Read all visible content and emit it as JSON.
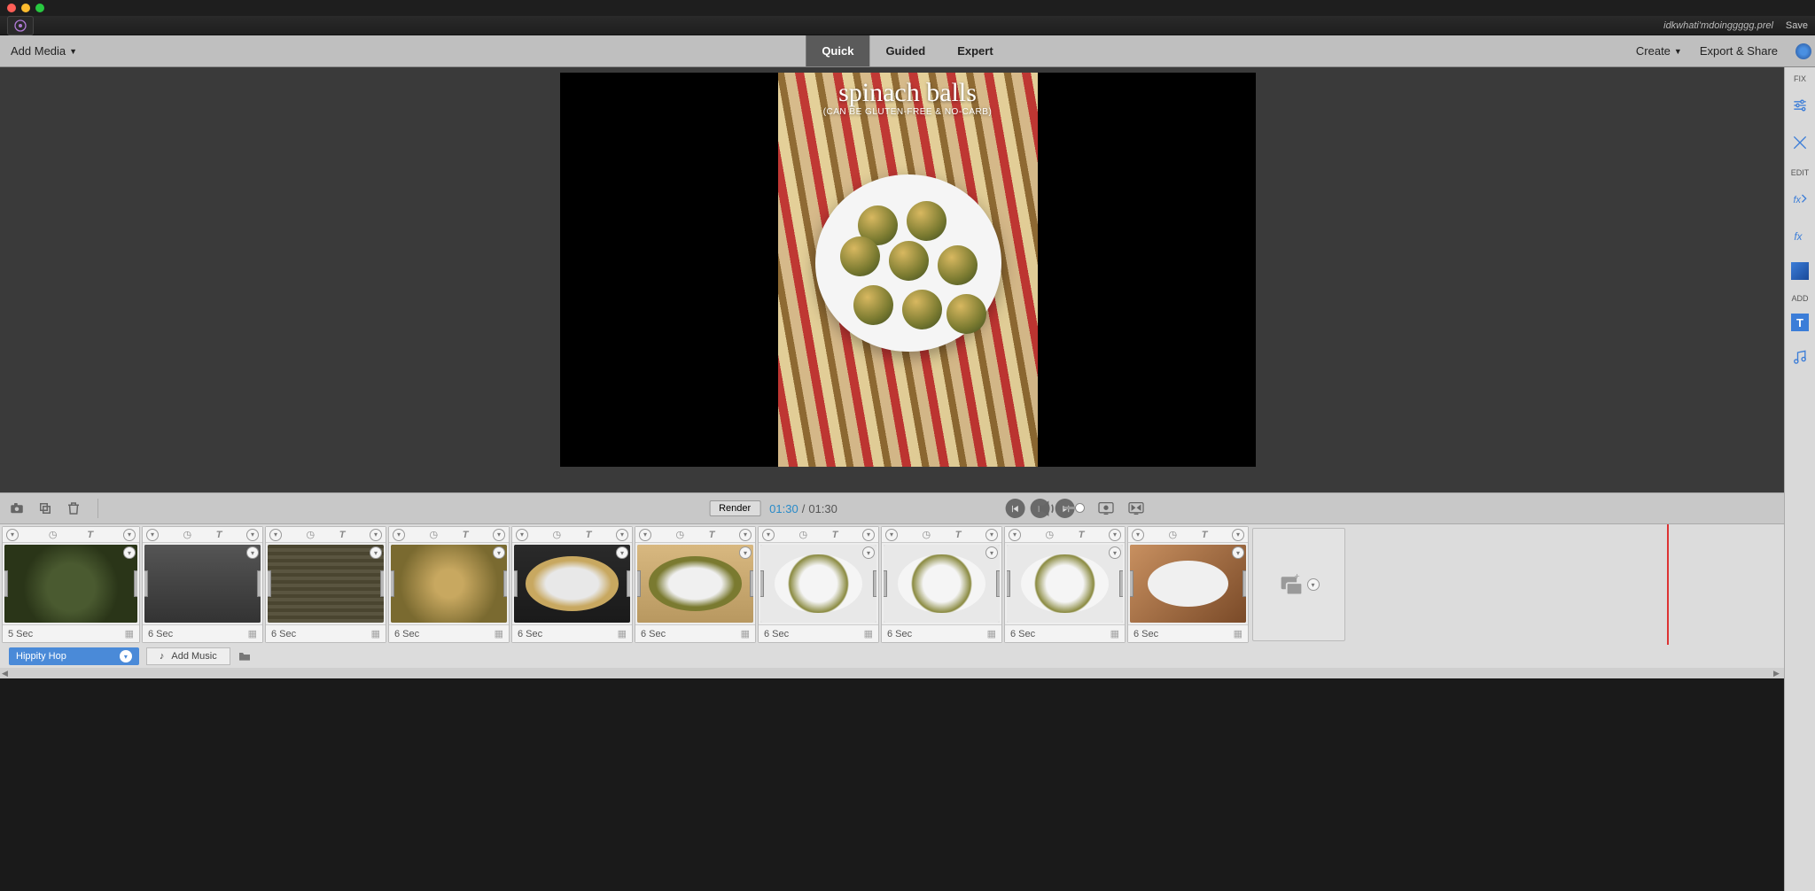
{
  "titlebar": {
    "filename": "idkwhati'mdoinggggg.prel",
    "save": "Save"
  },
  "menubar": {
    "addMedia": "Add Media",
    "tabs": {
      "quick": "Quick",
      "guided": "Guided",
      "expert": "Expert"
    },
    "create": "Create",
    "exportShare": "Export & Share"
  },
  "preview": {
    "title": "spinach balls",
    "subtitle": "(CAN BE GLUTEN-FREE & NO-CARB)"
  },
  "sidepanel": {
    "fix": "FIX",
    "edit": "EDIT",
    "add": "ADD",
    "t": "T"
  },
  "controls": {
    "render": "Render",
    "current": "01:30",
    "sep": "/",
    "total": "01:30"
  },
  "clips": [
    {
      "dur": "5 Sec",
      "thumbCls": "mt1"
    },
    {
      "dur": "6 Sec",
      "thumbCls": "mt2"
    },
    {
      "dur": "6 Sec",
      "thumbCls": "mt3"
    },
    {
      "dur": "6 Sec",
      "thumbCls": "mt4"
    },
    {
      "dur": "6 Sec",
      "thumbCls": "mt5"
    },
    {
      "dur": "6 Sec",
      "thumbCls": "mt6"
    },
    {
      "dur": "6 Sec",
      "thumbCls": "mt7"
    },
    {
      "dur": "6 Sec",
      "thumbCls": "mt8"
    },
    {
      "dur": "6 Sec",
      "thumbCls": "mt9"
    },
    {
      "dur": "6 Sec",
      "thumbCls": "mt10"
    }
  ],
  "music": {
    "selected": "Hippity Hop",
    "add": "Add Music"
  }
}
